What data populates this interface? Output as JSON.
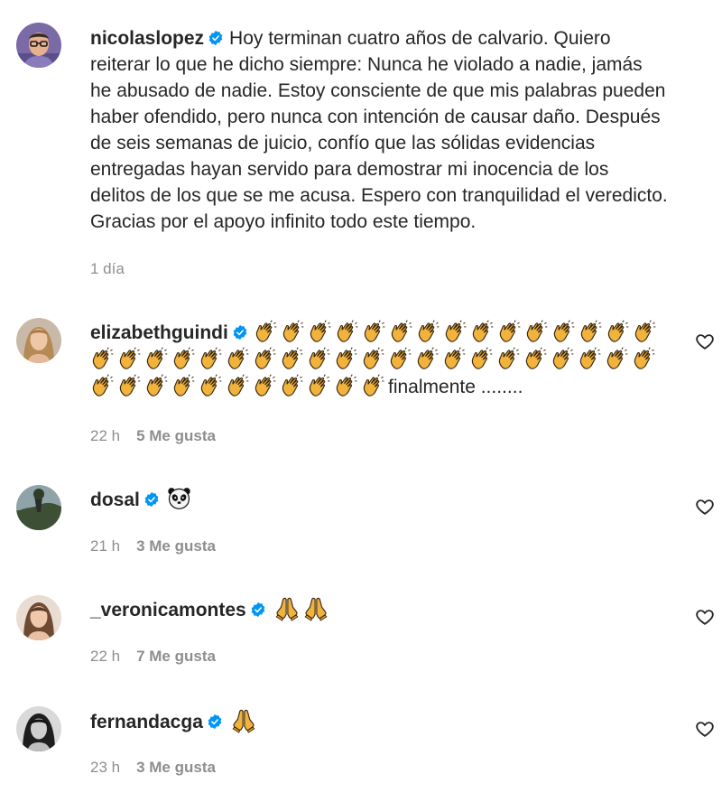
{
  "comments": [
    {
      "username": "nicolaslopez",
      "verified": true,
      "text": "Hoy terminan cuatro años de calvario. Quiero reiterar lo que he dicho siempre: Nunca he violado a nadie, jamás he abusado de nadie. Estoy consciente de que mis palabras pueden haber ofendido, pero nunca con intención de causar daño. Después de seis semanas de juicio, confío que las sólidas evidencias entregadas hayan servido para demostrar mi inocencia de los delitos de los que se me acusa. Espero con tranquilidad el veredicto. Gracias por el apoyo infinito todo este tiempo.",
      "time": "1 día",
      "avatar_icon": "avatar-man-glasses"
    },
    {
      "username": "elizabethguindi",
      "verified": true,
      "emoji": "clapping-hands",
      "emoji_count": 47,
      "text": "finalmente ........",
      "time": "22 h",
      "likes": "5 Me gusta",
      "avatar_icon": "avatar-woman-blonde"
    },
    {
      "username": "dosal",
      "verified": true,
      "emoji": "panda",
      "time": "21 h",
      "likes": "3 Me gusta",
      "avatar_icon": "avatar-landscape"
    },
    {
      "username": "_veronicamontes",
      "verified": true,
      "emoji": "folded-hands",
      "emoji_count": 2,
      "time": "22 h",
      "likes": "7 Me gusta",
      "avatar_icon": "avatar-woman-brunette"
    },
    {
      "username": "fernandacga",
      "verified": true,
      "emoji": "folded-hands",
      "emoji_count": 1,
      "time": "23 h",
      "likes": "3 Me gusta",
      "avatar_icon": "avatar-woman-bw"
    }
  ],
  "colors": {
    "text": "#262626",
    "meta": "#8e8e8e",
    "verified": "#0095f6"
  },
  "icons": {
    "like": "heart-outline-icon",
    "verified": "verified-badge-icon"
  }
}
